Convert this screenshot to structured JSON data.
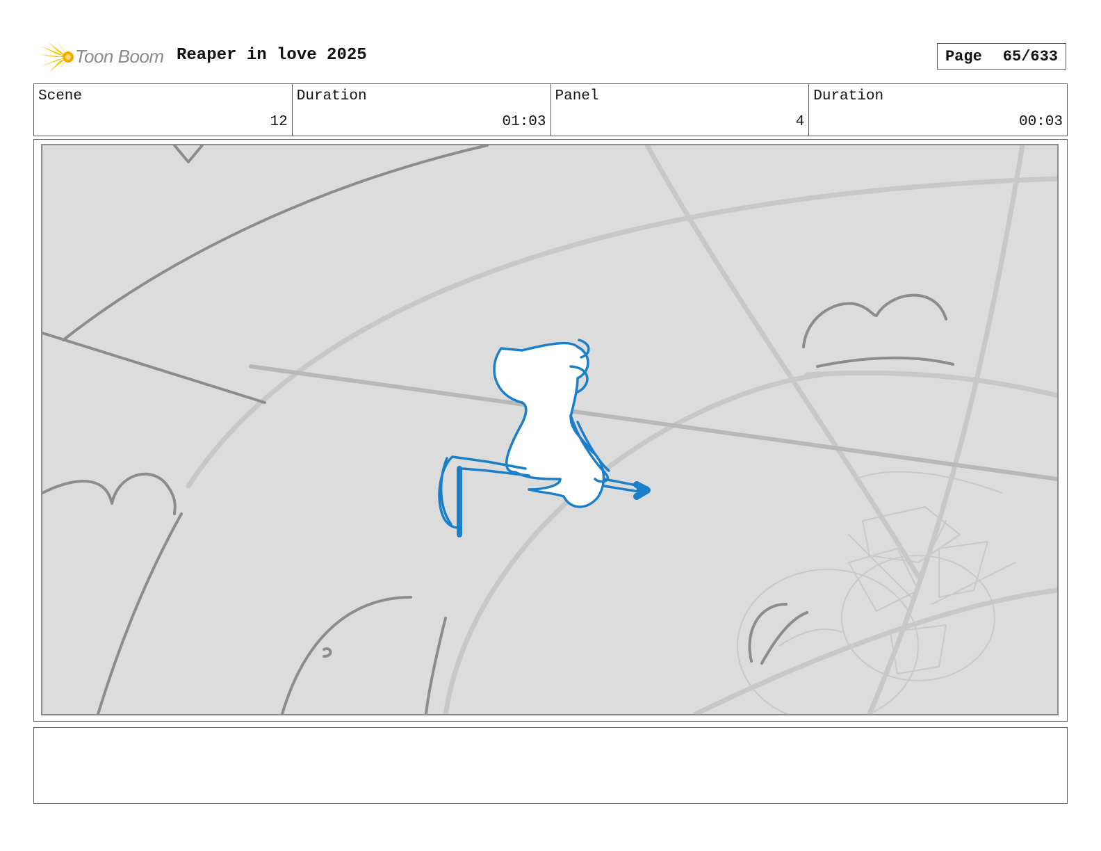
{
  "header": {
    "logo_text": "Toon Boom",
    "project_title": "Reaper in love 2025",
    "page_label": "Page",
    "page_value": "65/633"
  },
  "info": {
    "scene_label": "Scene",
    "scene_value": "12",
    "scene_duration_label": "Duration",
    "scene_duration_value": "01:03",
    "panel_label": "Panel",
    "panel_value": "4",
    "panel_duration_label": "Duration",
    "panel_duration_value": "00:03"
  },
  "colors": {
    "sketch_blue": "#1a7fc8",
    "sketch_gray": "#8c8c8c",
    "panel_bg": "#dcdcdc",
    "logo_yellow": "#f5c400"
  },
  "notes": {
    "text": ""
  }
}
